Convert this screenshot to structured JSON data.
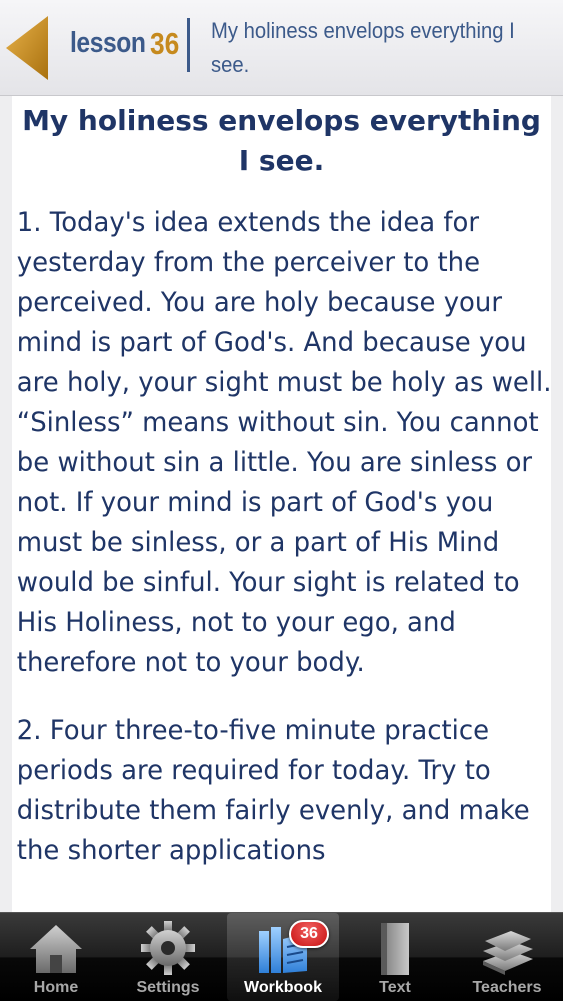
{
  "header": {
    "lesson_word": "lesson",
    "lesson_number": "36",
    "title": "My holiness envelops everything I see."
  },
  "lesson": {
    "heading": "My holiness envelops everything I see.",
    "paragraphs": [
      "1. Today's idea extends the idea for yesterday from the perceiver to the perceived. You are holy because your mind is part of God's. And because you are holy, your sight must be holy as well. “Sinless” means without sin. You cannot be without sin a little. You are sinless or not. If your mind is part of God's you must be sinless, or a part of His Mind would be sinful. Your sight is related to His Holiness, not to your ego, and therefore not to your body.",
      "2. Four three-to-five minute practice periods are required for today. Try to distribute them fairly evenly, and make the shorter applications"
    ]
  },
  "tabbar": {
    "tabs": [
      {
        "label": "Home",
        "icon": "house-icon"
      },
      {
        "label": "Settings",
        "icon": "gear-icon"
      },
      {
        "label": "Workbook",
        "icon": "workbook-icon",
        "badge": "36",
        "active": true
      },
      {
        "label": "Text",
        "icon": "book-icon"
      },
      {
        "label": "Teachers",
        "icon": "books-stack-icon"
      }
    ]
  },
  "colors": {
    "text_navy": "#1f3566",
    "header_blue": "#3c5a8a",
    "accent_gold": "#c68a1e",
    "badge_red": "#d41a1a"
  }
}
